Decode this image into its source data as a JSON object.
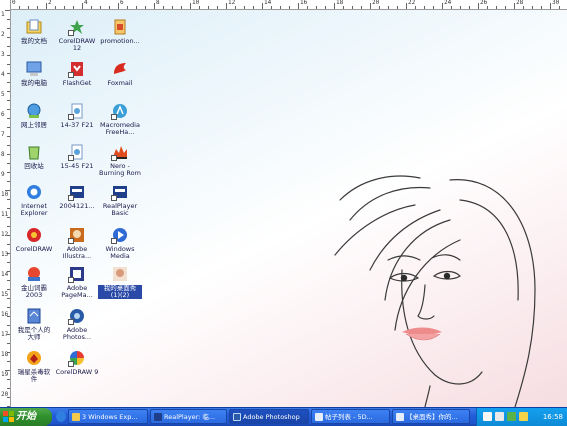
{
  "ruler": {
    "top_numbers": [
      "0",
      "2",
      "4",
      "6",
      "8",
      "10",
      "12",
      "14",
      "16",
      "18",
      "20",
      "22",
      "24",
      "26",
      "28",
      "30"
    ],
    "left_numbers": [
      "1",
      "2",
      "3",
      "4",
      "5",
      "6",
      "7",
      "8",
      "9",
      "10",
      "11",
      "12",
      "13",
      "14",
      "15",
      "16",
      "17",
      "18",
      "19",
      "20"
    ]
  },
  "desktop_icons": [
    {
      "label": "我的文档",
      "icon": "my-documents-icon"
    },
    {
      "label": "我的电脑",
      "icon": "my-computer-icon"
    },
    {
      "label": "网上邻居",
      "icon": "network-icon"
    },
    {
      "label": "回收站",
      "icon": "recycle-bin-icon"
    },
    {
      "label": "Internet\nExplorer",
      "icon": "ie-icon"
    },
    {
      "label": "CorelDRAW",
      "icon": "corel-icon"
    },
    {
      "label": "金山词霸\n2003",
      "icon": "kingsoft-icon"
    },
    {
      "label": "我是个人的\n大师",
      "icon": "master-icon"
    },
    {
      "label": "瑞星杀毒软\n件",
      "icon": "rising-antivirus-icon"
    },
    {
      "label": "CorelDRAW\n12",
      "icon": "coreldraw-icon"
    },
    {
      "label": "FlashGet",
      "icon": "flashget-icon"
    },
    {
      "label": "14-37 F21",
      "icon": "file-icon"
    },
    {
      "label": "15-45 F21",
      "icon": "file-icon"
    },
    {
      "label": "2004121...",
      "icon": "realmedia-icon"
    },
    {
      "label": "Adobe\nIllustra...",
      "icon": "illustrator-icon"
    },
    {
      "label": "Adobe\nPageMa...",
      "icon": "pagemaker-icon"
    },
    {
      "label": "Adobe\nPhotos...",
      "icon": "photoshop-icon"
    },
    {
      "label": "CorelDRAW 9",
      "icon": "coreldraw9-icon"
    },
    {
      "label": "promotion...",
      "icon": "document-icon"
    },
    {
      "label": "Foxmail",
      "icon": "foxmail-icon"
    },
    {
      "label": "Macromedia\nFreeHa...",
      "icon": "freehand-icon"
    },
    {
      "label": "Nero -\nBurning Rom",
      "icon": "nero-icon"
    },
    {
      "label": "RealPlayer\nBasic",
      "icon": "realplayer-icon"
    },
    {
      "label": "Windows\nMedia",
      "icon": "windows-media-icon"
    },
    {
      "label": "我的桌面秀\n(1)(2)",
      "icon": "desktop-show-icon"
    }
  ],
  "taskbar": {
    "start_label": "开始",
    "tasks": [
      {
        "label": "3 Windows Exp...",
        "icon": "folder-icon"
      },
      {
        "label": "RealPlayer: 临...",
        "icon": "realplayer-icon"
      },
      {
        "label": "Adobe Photoshop",
        "icon": "photoshop-icon"
      },
      {
        "label": "帖子列表 - 5D...",
        "icon": "browser-icon"
      },
      {
        "label": "【桌面秀】你的...",
        "icon": "browser-icon"
      }
    ],
    "clock": "16:58"
  },
  "colors": {
    "taskbar_blue": "#245edb",
    "start_green": "#2f8f2c",
    "tray_blue": "#0d8ad6"
  }
}
